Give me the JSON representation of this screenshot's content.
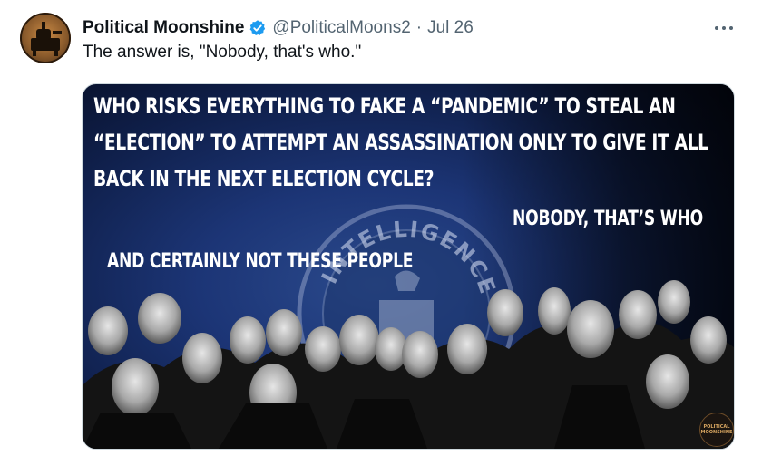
{
  "tweet": {
    "author_name": "Political Moonshine",
    "handle": "@PoliticalMoons2",
    "separator": "·",
    "date": "Jul 26",
    "text": "The answer is, \"Nobody, that's who.\"",
    "verified_badge_color": "#1d9bf0",
    "more_icon": "more-horizontal-icon"
  },
  "media": {
    "headline_lines": [
      "WHO RISKS EVERYTHING TO FAKE A “PANDEMIC” TO STEAL AN",
      "“ELECTION” TO ATTEMPT AN ASSASSINATION ONLY TO GIVE IT ALL",
      "BACK IN THE NEXT ELECTION CYCLE?"
    ],
    "answer_text": "NOBODY, THAT’S WHO",
    "caption_text": "AND CERTAINLY NOT THESE PEOPLE",
    "seal_text": "INTELLIGENCE",
    "watermark_lines": [
      "POLITICAL",
      "MOONSHINE"
    ]
  }
}
